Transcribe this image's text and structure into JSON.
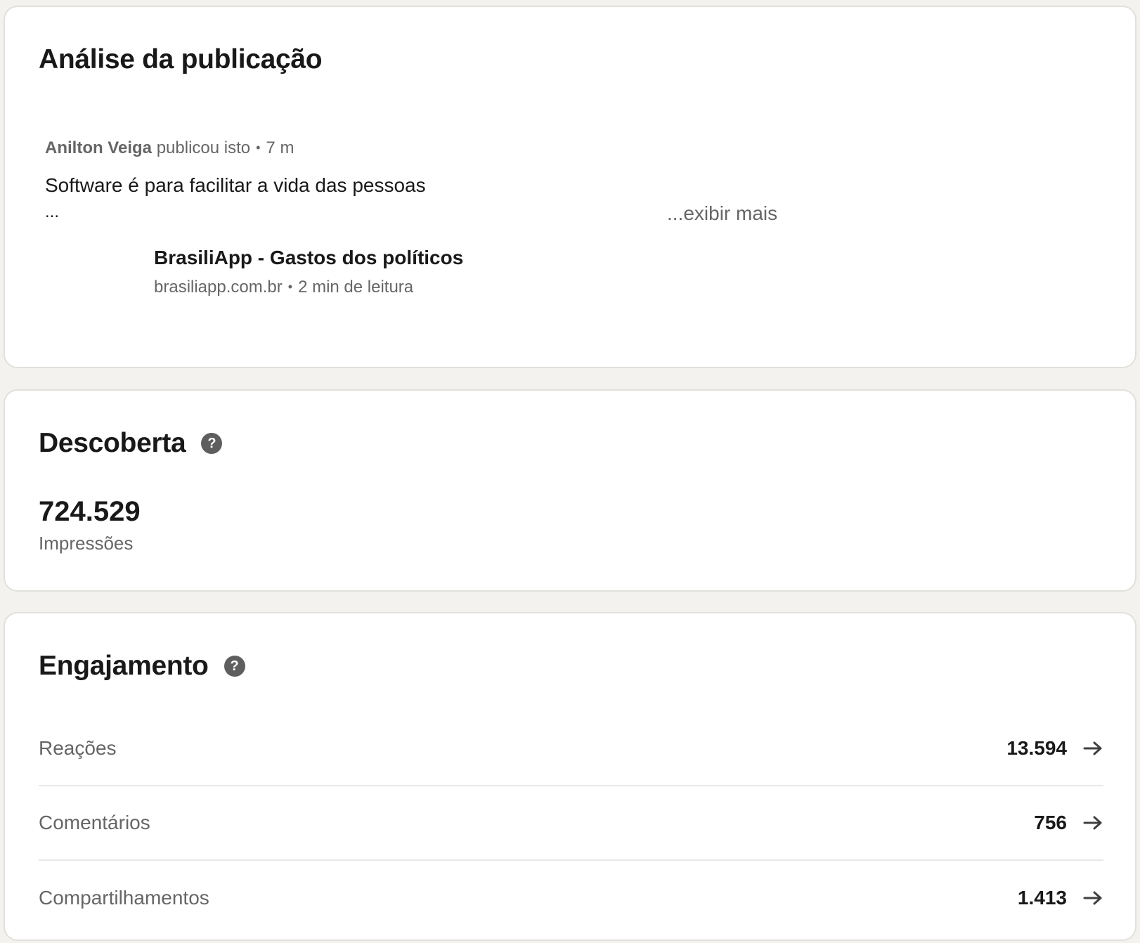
{
  "post_card": {
    "title": "Análise da publicação",
    "author": "Anilton Veiga",
    "action": "publicou isto",
    "time": "7 m",
    "text": "Software é para facilitar a vida das pessoas",
    "ellipsis": "...",
    "show_more": "...exibir mais",
    "article": {
      "title": "BrasiliApp - Gastos dos políticos",
      "domain": "brasiliapp.com.br",
      "read_time": "2 min de leitura"
    }
  },
  "discovery": {
    "title": "Descoberta",
    "help_icon": "question-circle-icon",
    "impressions_value": "724.529",
    "impressions_label": "Impressões"
  },
  "engagement": {
    "title": "Engajamento",
    "help_icon": "question-circle-icon",
    "rows": [
      {
        "label": "Reações",
        "value": "13.594",
        "icon": "arrow-right-icon"
      },
      {
        "label": "Comentários",
        "value": "756",
        "icon": "arrow-right-icon"
      },
      {
        "label": "Compartilhamentos",
        "value": "1.413",
        "icon": "arrow-right-icon"
      }
    ]
  },
  "colors": {
    "page_background": "#f3f2ef",
    "card_background": "#ffffff",
    "primary_text": "#191919",
    "secondary_text": "#666666",
    "icon_gray": "#5e5e5e"
  }
}
